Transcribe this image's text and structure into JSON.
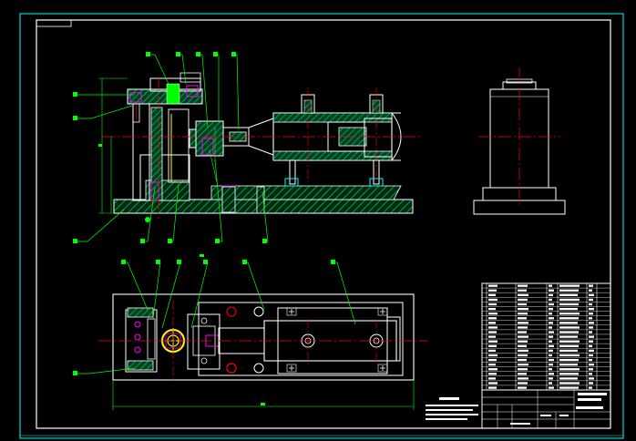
{
  "drawing": {
    "background": "#000000",
    "colors": {
      "frame": "#ffffff",
      "outer_frame": "#00ffff",
      "centerline": "#ff0000",
      "leader": "#00ff00",
      "hatch": "#00a050",
      "part_outline": "#ffffff",
      "cyan": "#00ffff",
      "magenta": "#ff00ff",
      "yellow": "#ffff00"
    },
    "title_block_rows": 23
  }
}
